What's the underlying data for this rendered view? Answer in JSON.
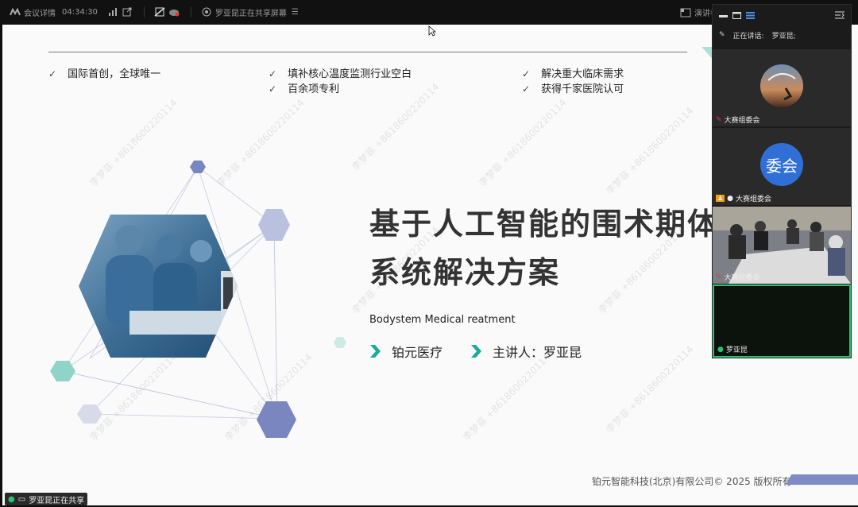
{
  "topbar": {
    "meeting_details": "会议详情",
    "elapsed_time": "04:34:30",
    "sharing_notice": "罗亚昆正在共享屏幕",
    "presenter_label": "演讲者"
  },
  "slide": {
    "bullets_col1": [
      "国际首创，全球唯一"
    ],
    "bullets_col2": [
      "填补核心温度监测行业空白",
      "百余项专利"
    ],
    "bullets_col3": [
      "解决重大临床需求",
      "获得千家医院认可"
    ],
    "title_line1": "基于人工智能的围术期体",
    "title_line2": "系统解决方案",
    "subtitle_en": "Bodystem Medical reatment",
    "company": "铂元医疗",
    "presenter": "主讲人：罗亚昆",
    "footer": "铂元智能科技(北京)有限公司© 2025 版权所有",
    "watermark": "李梦菲 +8618600220114"
  },
  "share_status": "罗亚昆正在共享",
  "panel": {
    "speaking_label": "正在讲话:",
    "speaking_name": "罗亚昆;",
    "participants": [
      {
        "name": "大赛组委会"
      },
      {
        "name": "大赛组委会",
        "avatar_text": "委会"
      },
      {
        "name": "大赛组委会"
      },
      {
        "name": "罗亚昆"
      }
    ]
  },
  "colors": {
    "accent_teal": "#1aab9b",
    "hex_blue": "#7a86c0",
    "hex_light": "#b9c1de",
    "hex_teal": "#8fd3c9",
    "footer_bar": "#7e8bc4",
    "avatar_blue": "#2f6fd6",
    "active_border": "#2fbf71"
  }
}
